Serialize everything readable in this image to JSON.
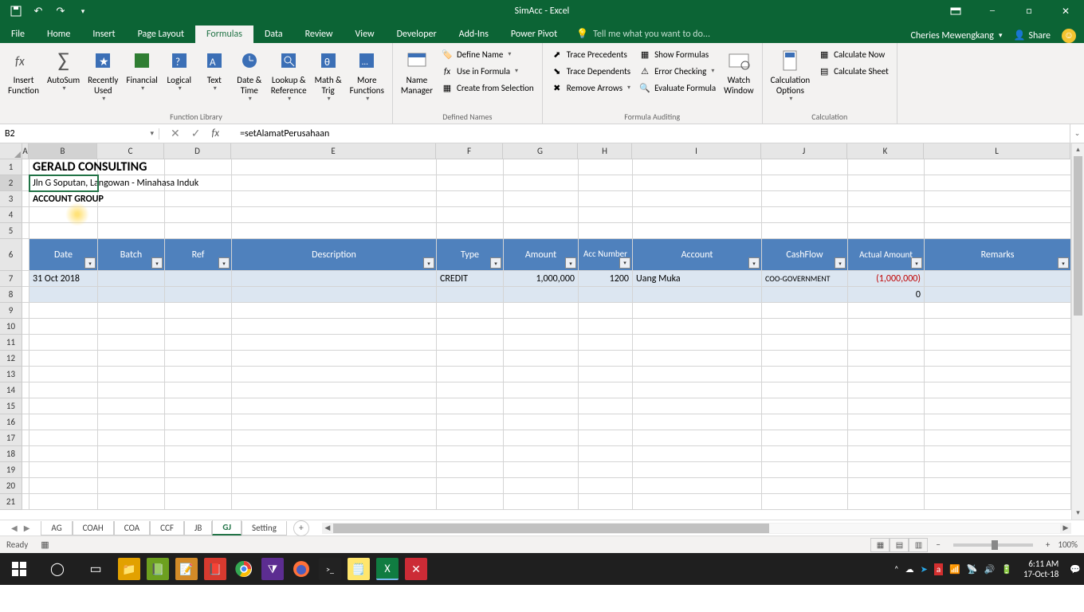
{
  "title": "SimAcc - Excel",
  "user": "Cheries Mewengkang",
  "share": "Share",
  "tabs": [
    "File",
    "Home",
    "Insert",
    "Page Layout",
    "Formulas",
    "Data",
    "Review",
    "View",
    "Developer",
    "Add-Ins",
    "Power Pivot"
  ],
  "active_tab": "Formulas",
  "tell_me": "Tell me what you want to do...",
  "ribbon": {
    "function_library": {
      "label": "Function Library",
      "insert_function": "Insert\nFunction",
      "autosum": "AutoSum",
      "recently_used": "Recently\nUsed",
      "financial": "Financial",
      "logical": "Logical",
      "text": "Text",
      "date_time": "Date &\nTime",
      "lookup": "Lookup &\nReference",
      "math_trig": "Math &\nTrig",
      "more": "More\nFunctions"
    },
    "defined_names": {
      "label": "Defined Names",
      "name_manager": "Name\nManager",
      "define_name": "Define Name",
      "use_in_formula": "Use in Formula",
      "create_selection": "Create from Selection"
    },
    "formula_auditing": {
      "label": "Formula Auditing",
      "trace_precedents": "Trace Precedents",
      "trace_dependents": "Trace Dependents",
      "remove_arrows": "Remove Arrows",
      "show_formulas": "Show Formulas",
      "error_checking": "Error Checking",
      "evaluate": "Evaluate Formula",
      "watch": "Watch\nWindow"
    },
    "calculation": {
      "label": "Calculation",
      "options": "Calculation\nOptions",
      "now": "Calculate Now",
      "sheet": "Calculate Sheet"
    }
  },
  "name_box": "B2",
  "formula": "=setAlamatPerusahaan",
  "columns": [
    "A",
    "B",
    "C",
    "D",
    "E",
    "F",
    "G",
    "H",
    "I",
    "J",
    "K",
    "L"
  ],
  "row_numbers": [
    "1",
    "2",
    "3",
    "4",
    "5",
    "6",
    "7",
    "8",
    "9",
    "10",
    "11",
    "12",
    "13",
    "14",
    "15",
    "16",
    "17",
    "18",
    "19",
    "20",
    "21"
  ],
  "sheet": {
    "company": "GERALD CONSULTING",
    "address": "Jln G Soputan, Langowan - Minahasa Induk",
    "title": "ACCOUNT GROUP",
    "headers": [
      "Date",
      "Batch",
      "Ref",
      "Description",
      "Type",
      "Amount",
      "Acc Number",
      "Account",
      "CashFlow",
      "Actual Amount",
      "Remarks"
    ],
    "r7": {
      "date": "31 Oct 2018",
      "type": "CREDIT",
      "amount": "1,000,000",
      "accnum": "1200",
      "account": "Uang Muka",
      "cashflow": "COO-GOVERNMENT",
      "actual": "(1,000,000)"
    },
    "r8": {
      "actual": "0"
    }
  },
  "sheet_tabs": [
    "AG",
    "COAH",
    "COA",
    "CCF",
    "JB",
    "GJ",
    "Setting"
  ],
  "active_sheet": "GJ",
  "status": "Ready",
  "zoom": "100%",
  "clock": {
    "time": "6:11 AM",
    "date": "17-Oct-18"
  }
}
